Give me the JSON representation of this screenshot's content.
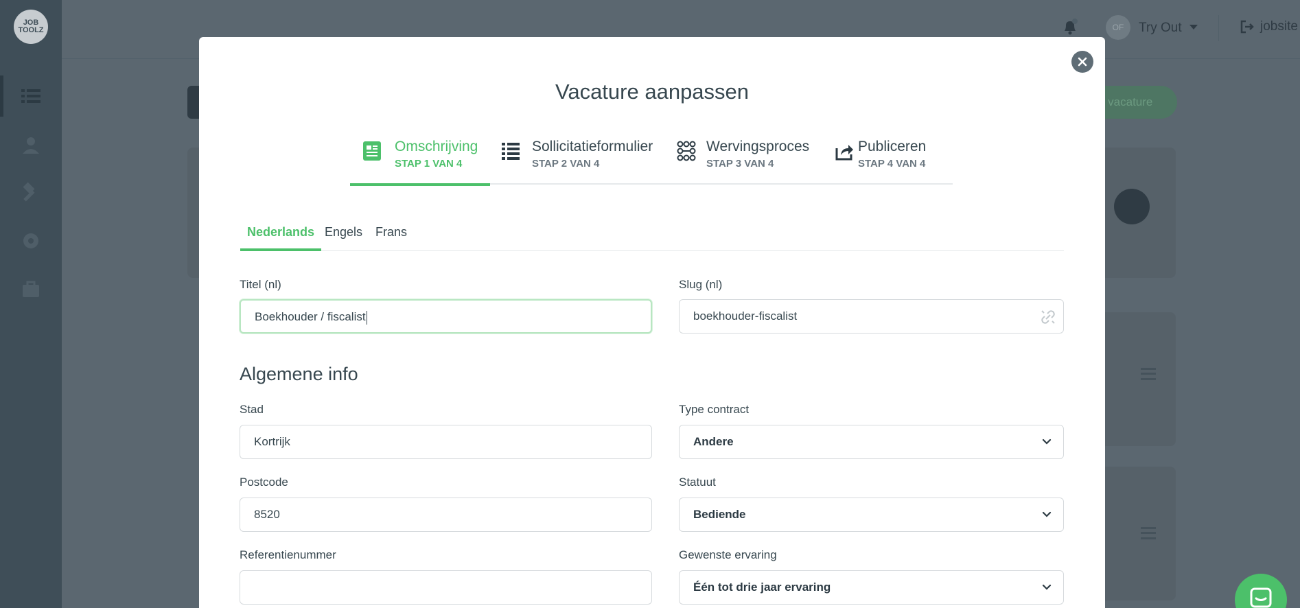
{
  "app": {
    "logo_text": "JOB TOOLZ",
    "user_initials": "OF",
    "user_name": "Try Out",
    "jobsite_label": "jobsite",
    "bg_button_label": "e vacature"
  },
  "modal": {
    "title": "Vacature aanpassen",
    "steps": [
      {
        "title": "Omschrijving",
        "subtitle": "STAP 1 VAN 4",
        "icon": "document-icon",
        "active": true
      },
      {
        "title": "Sollicitatieformulier",
        "subtitle": "STAP 2 VAN 4",
        "icon": "list-icon",
        "active": false
      },
      {
        "title": "Wervingsproces",
        "subtitle": "STAP 3 VAN 4",
        "icon": "process-icon",
        "active": false
      },
      {
        "title": "Publiceren",
        "subtitle": "STAP 4 VAN 4",
        "icon": "share-icon",
        "active": false
      }
    ],
    "language_tabs": [
      {
        "label": "Nederlands",
        "active": true
      },
      {
        "label": "Engels",
        "active": false
      },
      {
        "label": "Frans",
        "active": false
      }
    ],
    "title_field": {
      "label": "Titel (nl)",
      "value": "Boekhouder / fiscalist"
    },
    "slug_field": {
      "label": "Slug (nl)",
      "value": "boekhouder-fiscalist"
    },
    "section_general": "Algemene info",
    "city_field": {
      "label": "Stad",
      "value": "Kortrijk"
    },
    "postcode_field": {
      "label": "Postcode",
      "value": "8520"
    },
    "reference_field": {
      "label": "Referentienummer",
      "value": ""
    },
    "contract_select": {
      "label": "Type contract",
      "value": "Andere"
    },
    "status_select": {
      "label": "Statuut",
      "value": "Bediende"
    },
    "experience_select": {
      "label": "Gewenste ervaring",
      "value": "Één tot drie jaar ervaring"
    }
  },
  "colors": {
    "accent": "#4cc06a",
    "text": "#37474f",
    "overlay": "#5b6770"
  }
}
